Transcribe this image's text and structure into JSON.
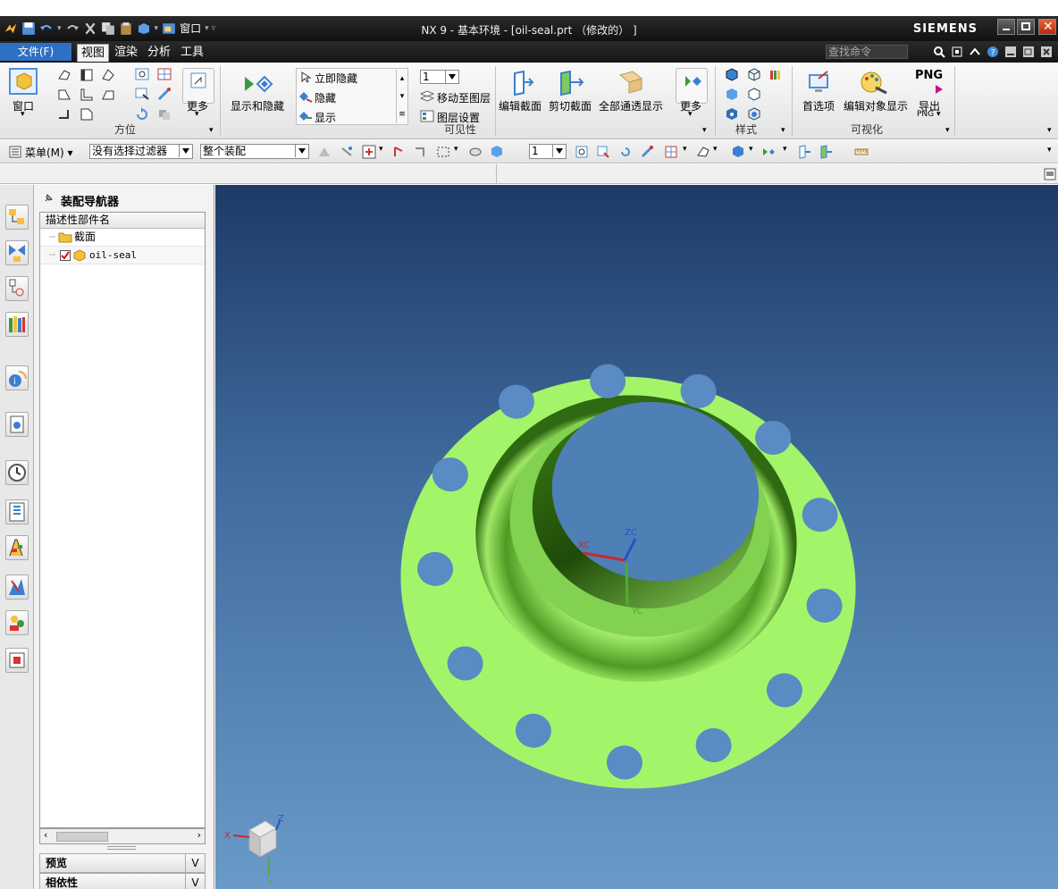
{
  "window": {
    "title": "NX 9 - 基本环境 - [oil-seal.prt （修改的） ]",
    "brand": "SIEMENS",
    "quick_access_menu": "窗口"
  },
  "tabs": {
    "file": "文件(F)",
    "view": "视图",
    "render": "渲染",
    "analysis": "分析",
    "tools": "工具"
  },
  "search": {
    "placeholder": "查找命令"
  },
  "ribbon": {
    "window_label": "窗口",
    "more1": "更多",
    "orientation_group": "方位",
    "show_hide": "显示和隐藏",
    "immediate_hide": "立即隐藏",
    "hide": "隐藏",
    "show": "显示",
    "layer_value": "1",
    "move_to_layer": "移动至图层",
    "layer_settings": "图层设置",
    "visibility_group": "可见性",
    "edit_section": "编辑截面",
    "clip_section": "剪切截面",
    "all_transparent": "全部通透显示",
    "more2": "更多",
    "style_group": "样式",
    "preferences": "首选项",
    "edit_object_display": "编辑对象显示",
    "export_png_top": "PNG",
    "export_label": "导出",
    "export_sub": "PNG",
    "visualization_group": "可视化"
  },
  "toolbar2": {
    "menu": "菜单(M)",
    "filter": "没有选择过滤器",
    "scope": "整个装配",
    "layer": "1"
  },
  "navigator": {
    "title": "装配导航器",
    "column": "描述性部件名",
    "items": [
      {
        "label": "截面",
        "type": "folder"
      },
      {
        "label": "oil-seal",
        "type": "part"
      }
    ],
    "panel_preview": "预览",
    "panel_dependency": "相依性"
  },
  "viewport": {
    "csys_labels": {
      "x": "XC",
      "y": "YC",
      "z": "ZC"
    },
    "triad_labels": {
      "x": "X",
      "y": "Y",
      "z": "Z"
    },
    "part_color": "#a4f46a"
  }
}
